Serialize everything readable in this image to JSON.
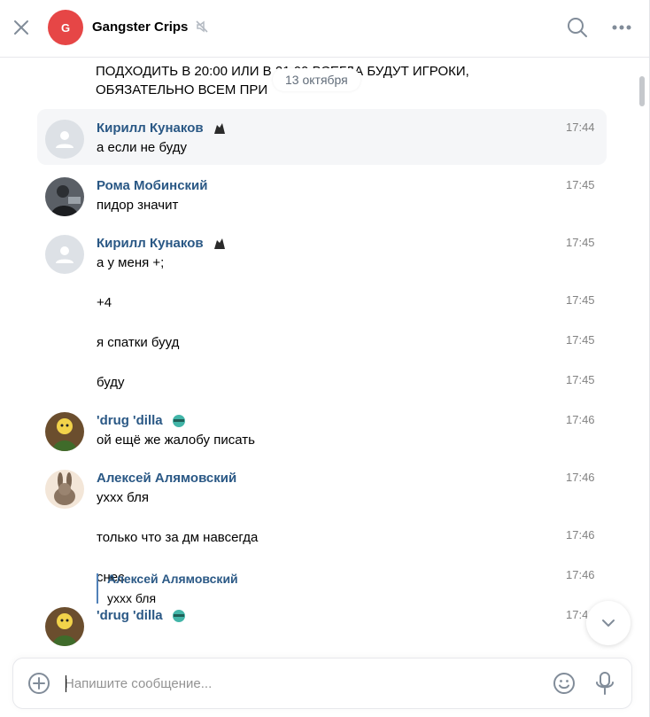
{
  "header": {
    "avatar_letter": "G",
    "avatar_color": "#e64646",
    "title": "Gangster Crips",
    "icons": [
      "close-icon",
      "muted-icon",
      "search-icon",
      "more-icon"
    ]
  },
  "pinned_fragment": {
    "line1": "ПОДХОДИТЬ В 20:00 ИЛИ В 21:00 ВСЕГДА БУДУТ ИГРОКИ,",
    "line2": "ОБЯЗАТЕЛЬНО ВСЕМ ПРИ"
  },
  "date_separator": "13 октября",
  "messages": [
    {
      "author": "Кирилл Кунаков",
      "text": "а если не буду",
      "time": "17:44"
    },
    {
      "author": "Рома Мобинский",
      "text": "пидор значит",
      "time": "17:45"
    },
    {
      "author": "Кирилл Кунаков",
      "text": "а у меня +;",
      "time": "17:45"
    },
    {
      "text": "+4",
      "time": "17:45"
    },
    {
      "text": "я спатки бууд",
      "time": "17:45"
    },
    {
      "text": "буду",
      "time": "17:45"
    },
    {
      "author": "'drug 'dilla",
      "text": "ой ещё же жалобу писать",
      "time": "17:46"
    },
    {
      "author": "Алексей Алямовский",
      "text": "уххх бля",
      "time": "17:46"
    },
    {
      "text": "только что за дм навсегда",
      "time": "17:46"
    },
    {
      "text": "снес",
      "time": "17:46"
    },
    {
      "author": "'drug 'dilla",
      "time": "17:4",
      "reply": {
        "author": "Алексей Алямовский",
        "text": "уххх бля"
      }
    }
  ],
  "composer": {
    "placeholder": "Напишите сообщение..."
  },
  "colors": {
    "link": "#2a5885",
    "accent": "#5181b8",
    "time": "#828282",
    "highlight": "#f5f6f8"
  }
}
